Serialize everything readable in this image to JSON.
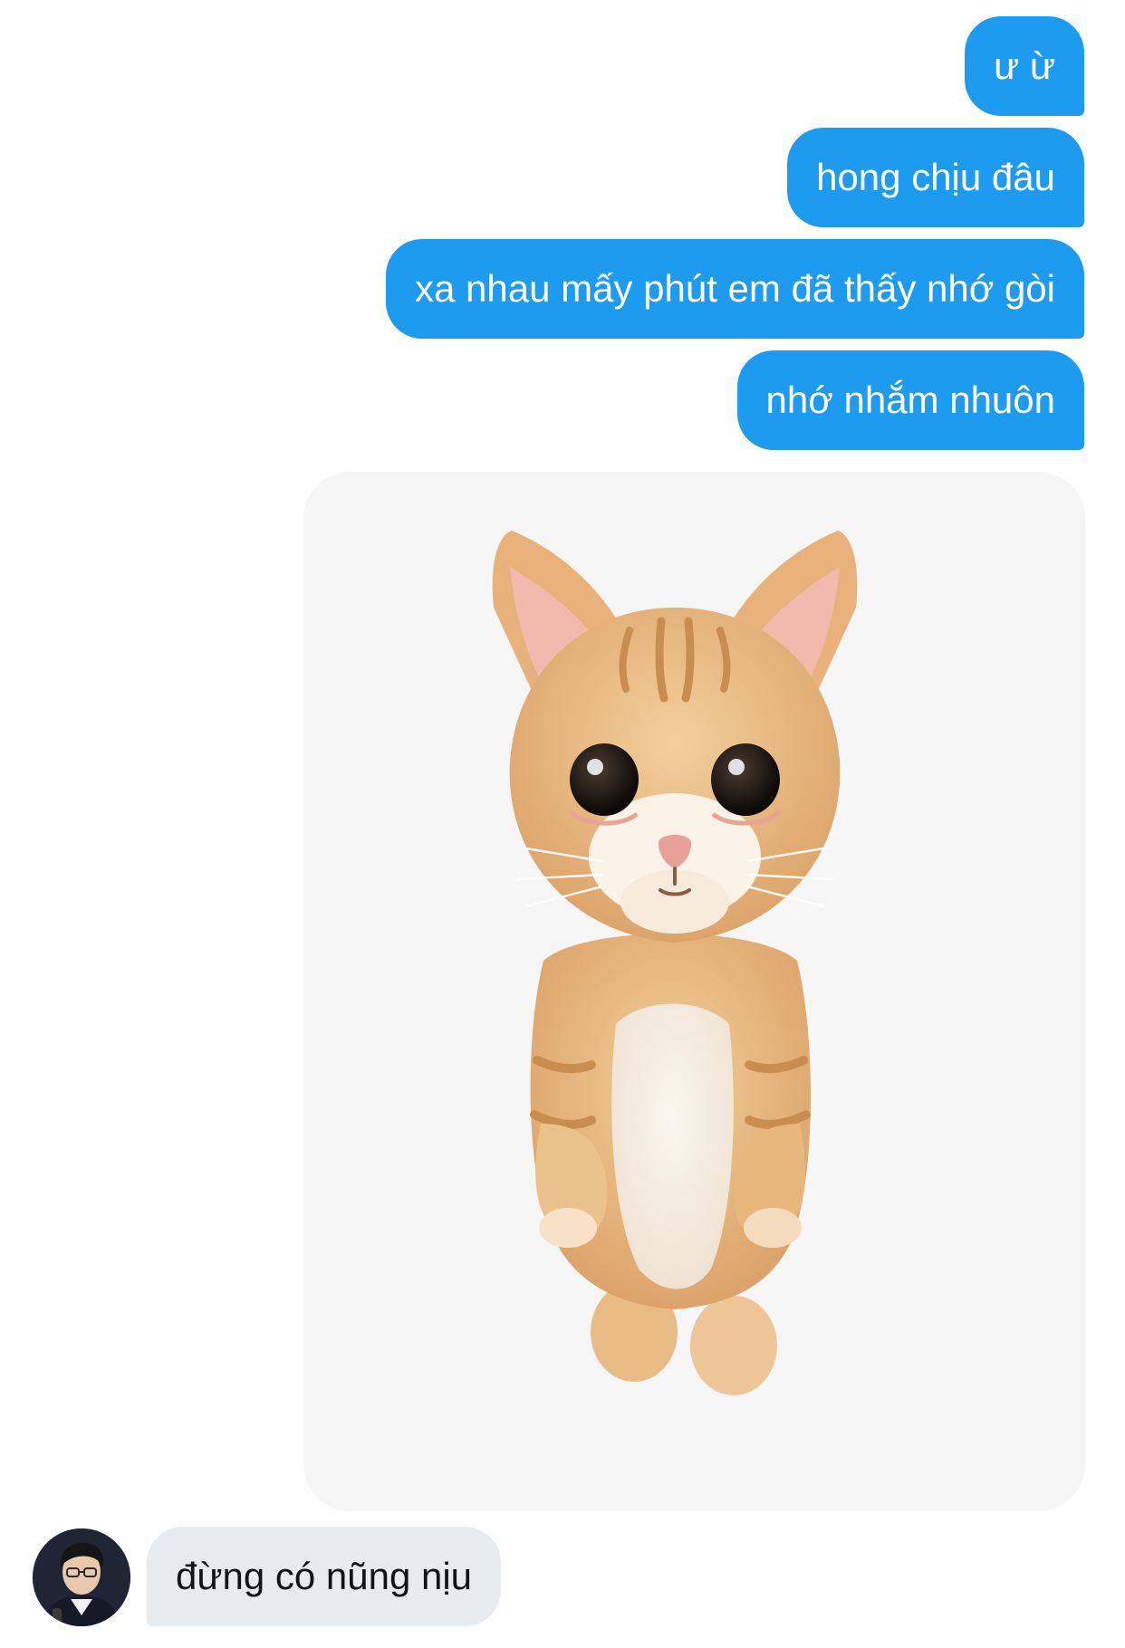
{
  "conversation": {
    "outgoing_messages": [
      {
        "text": "ư ừ"
      },
      {
        "text": "hong chịu đâu"
      },
      {
        "text": "xa nhau mấy phút em đã thấy nhớ gòi"
      },
      {
        "text": "nhớ nhắm nhuôn"
      }
    ],
    "outgoing_media": {
      "type": "sticker-image",
      "icon": "kitten-standing-sticker"
    },
    "incoming_messages": [
      {
        "text": "đừng có nũng nịu"
      }
    ],
    "incoming_avatar": {
      "icon": "user-avatar-photo"
    }
  },
  "colors": {
    "outgoing_bubble": "#1d9bf0",
    "incoming_bubble": "#e6ecf0",
    "media_background": "#f6f6f7"
  }
}
